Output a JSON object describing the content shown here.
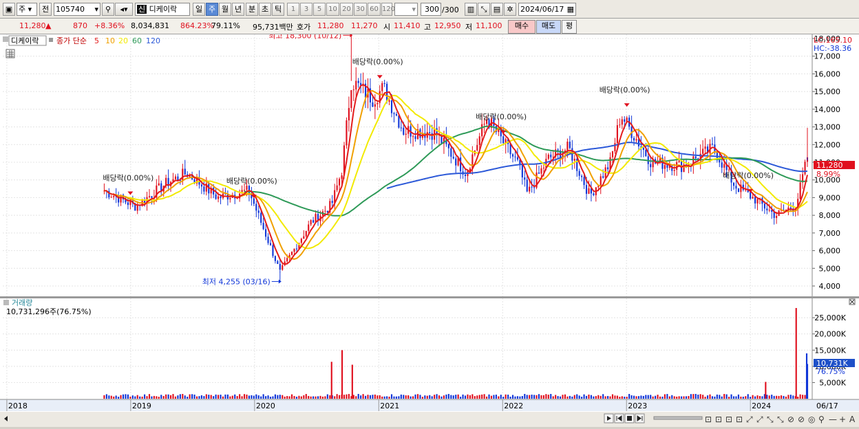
{
  "toolbar": {
    "period_select": "주",
    "prev_label": "전",
    "code": "105740",
    "badge": "신",
    "stock_name": "디케이락",
    "periods": [
      "일",
      "주",
      "월",
      "년",
      "분",
      "초",
      "틱"
    ],
    "active_period": "주",
    "numbers": [
      "1",
      "3",
      "5",
      "10",
      "20",
      "30",
      "60",
      "120"
    ],
    "count": "300",
    "count_total": "/300",
    "date": "2024/06/17"
  },
  "quote": {
    "price": "11,280",
    "arrow": "▲",
    "change": "870",
    "change_pct": "+8.36%",
    "volume": "8,034,831",
    "vol_ratio": "864.23%",
    "turnover": "79.11%",
    "amount": "95,731백만",
    "hoga_label": "호가",
    "hoga_ask": "11,280",
    "hoga_bid": "11,270",
    "open_label": "시",
    "open": "11,410",
    "high_label": "고",
    "high": "12,950",
    "low_label": "저",
    "low": "11,100",
    "buy_label": "매수",
    "sell_label": "매도",
    "eval_label": "평"
  },
  "price_panel": {
    "title": "디케이락",
    "legend_label": "종가 단순",
    "ma": [
      {
        "period": "5",
        "color": "#e31c1c"
      },
      {
        "period": "10",
        "color": "#f0a000"
      },
      {
        "period": "20",
        "color": "#f2ea00"
      },
      {
        "period": "60",
        "color": "#2e9a58"
      },
      {
        "period": "120",
        "color": "#2b58d8"
      }
    ],
    "lc": "LC:165.10",
    "hc": "HC:-38.36",
    "high_annotation": "최고 18,300 (10/12)",
    "low_annotation": "최저 4,255 (03/16)",
    "dividend_label": "배당락(0.00%)",
    "last_price_tag": "11,280",
    "last_pct_tag": "8.99%",
    "y_ticks": [
      "18,000",
      "17,000",
      "16,000",
      "15,000",
      "14,000",
      "13,000",
      "12,000",
      "11,000",
      "10,000",
      "9,000",
      "8,000",
      "7,000",
      "6,000",
      "5,000",
      "4,000"
    ]
  },
  "volume_panel": {
    "title": "거래량",
    "value": "10,731,296주(76.75%)",
    "tag_value": "10,731K",
    "tag_pct": "76.75%",
    "y_ticks": [
      "25,000K",
      "20,000K",
      "15,000K",
      "10,000K",
      "5,000K"
    ]
  },
  "x_axis": {
    "years": [
      "2018",
      "2019",
      "2020",
      "2021",
      "2022",
      "2023",
      "2024"
    ],
    "last_date": "06/17"
  },
  "chart_data": {
    "type": "candlestick",
    "interval": "weekly",
    "symbol": "105740",
    "name": "디케이락",
    "x_range": [
      "2018-10",
      "2024-06-17"
    ],
    "ylim": [
      4000,
      18000
    ],
    "keypoints": [
      {
        "date": "2018-10",
        "close": 9400
      },
      {
        "date": "2019-01",
        "close": 8500
      },
      {
        "date": "2019-04",
        "close": 9800
      },
      {
        "date": "2019-06",
        "close": 10400
      },
      {
        "date": "2019-09",
        "close": 9000
      },
      {
        "date": "2019-12",
        "close": 9400
      },
      {
        "date": "2020-03-16",
        "close": 4800,
        "low": 4255
      },
      {
        "date": "2020-06",
        "close": 7600
      },
      {
        "date": "2020-08",
        "close": 8600
      },
      {
        "date": "2020-09",
        "close": 10600
      },
      {
        "date": "2020-10-12",
        "close": 15600,
        "high": 18300
      },
      {
        "date": "2020-12",
        "close": 14600
      },
      {
        "date": "2021-01",
        "close": 15200
      },
      {
        "date": "2021-03",
        "close": 12800
      },
      {
        "date": "2021-06",
        "close": 12700
      },
      {
        "date": "2021-09",
        "close": 10400
      },
      {
        "date": "2021-11",
        "close": 13500
      },
      {
        "date": "2022-02",
        "close": 10900
      },
      {
        "date": "2022-03",
        "close": 9200
      },
      {
        "date": "2022-05",
        "close": 11200
      },
      {
        "date": "2022-07",
        "close": 11800
      },
      {
        "date": "2022-09",
        "close": 9100
      },
      {
        "date": "2022-11",
        "close": 11000
      },
      {
        "date": "2022-12",
        "close": 13700
      },
      {
        "date": "2023-03",
        "close": 11000
      },
      {
        "date": "2023-06",
        "close": 10800
      },
      {
        "date": "2023-09",
        "close": 11800
      },
      {
        "date": "2023-11",
        "close": 9700
      },
      {
        "date": "2024-01",
        "close": 8900
      },
      {
        "date": "2024-03",
        "close": 8000
      },
      {
        "date": "2024-05",
        "close": 8600
      },
      {
        "date": "2024-06-17",
        "open": 11410,
        "high": 12950,
        "low": 11100,
        "close": 11280
      }
    ],
    "volume_ylim": [
      0,
      28000000
    ],
    "volume_spikes": [
      {
        "date": "2020-08",
        "volume": 11400000
      },
      {
        "date": "2020-09",
        "volume": 15000000
      },
      {
        "date": "2020-10",
        "volume": 10500000
      },
      {
        "date": "2024-02",
        "volume": 5200000
      },
      {
        "date": "2024-05",
        "volume": 28000000
      },
      {
        "date": "2024-06",
        "volume": 14000000
      },
      {
        "date": "2024-06-17",
        "volume": 10731296
      }
    ]
  }
}
